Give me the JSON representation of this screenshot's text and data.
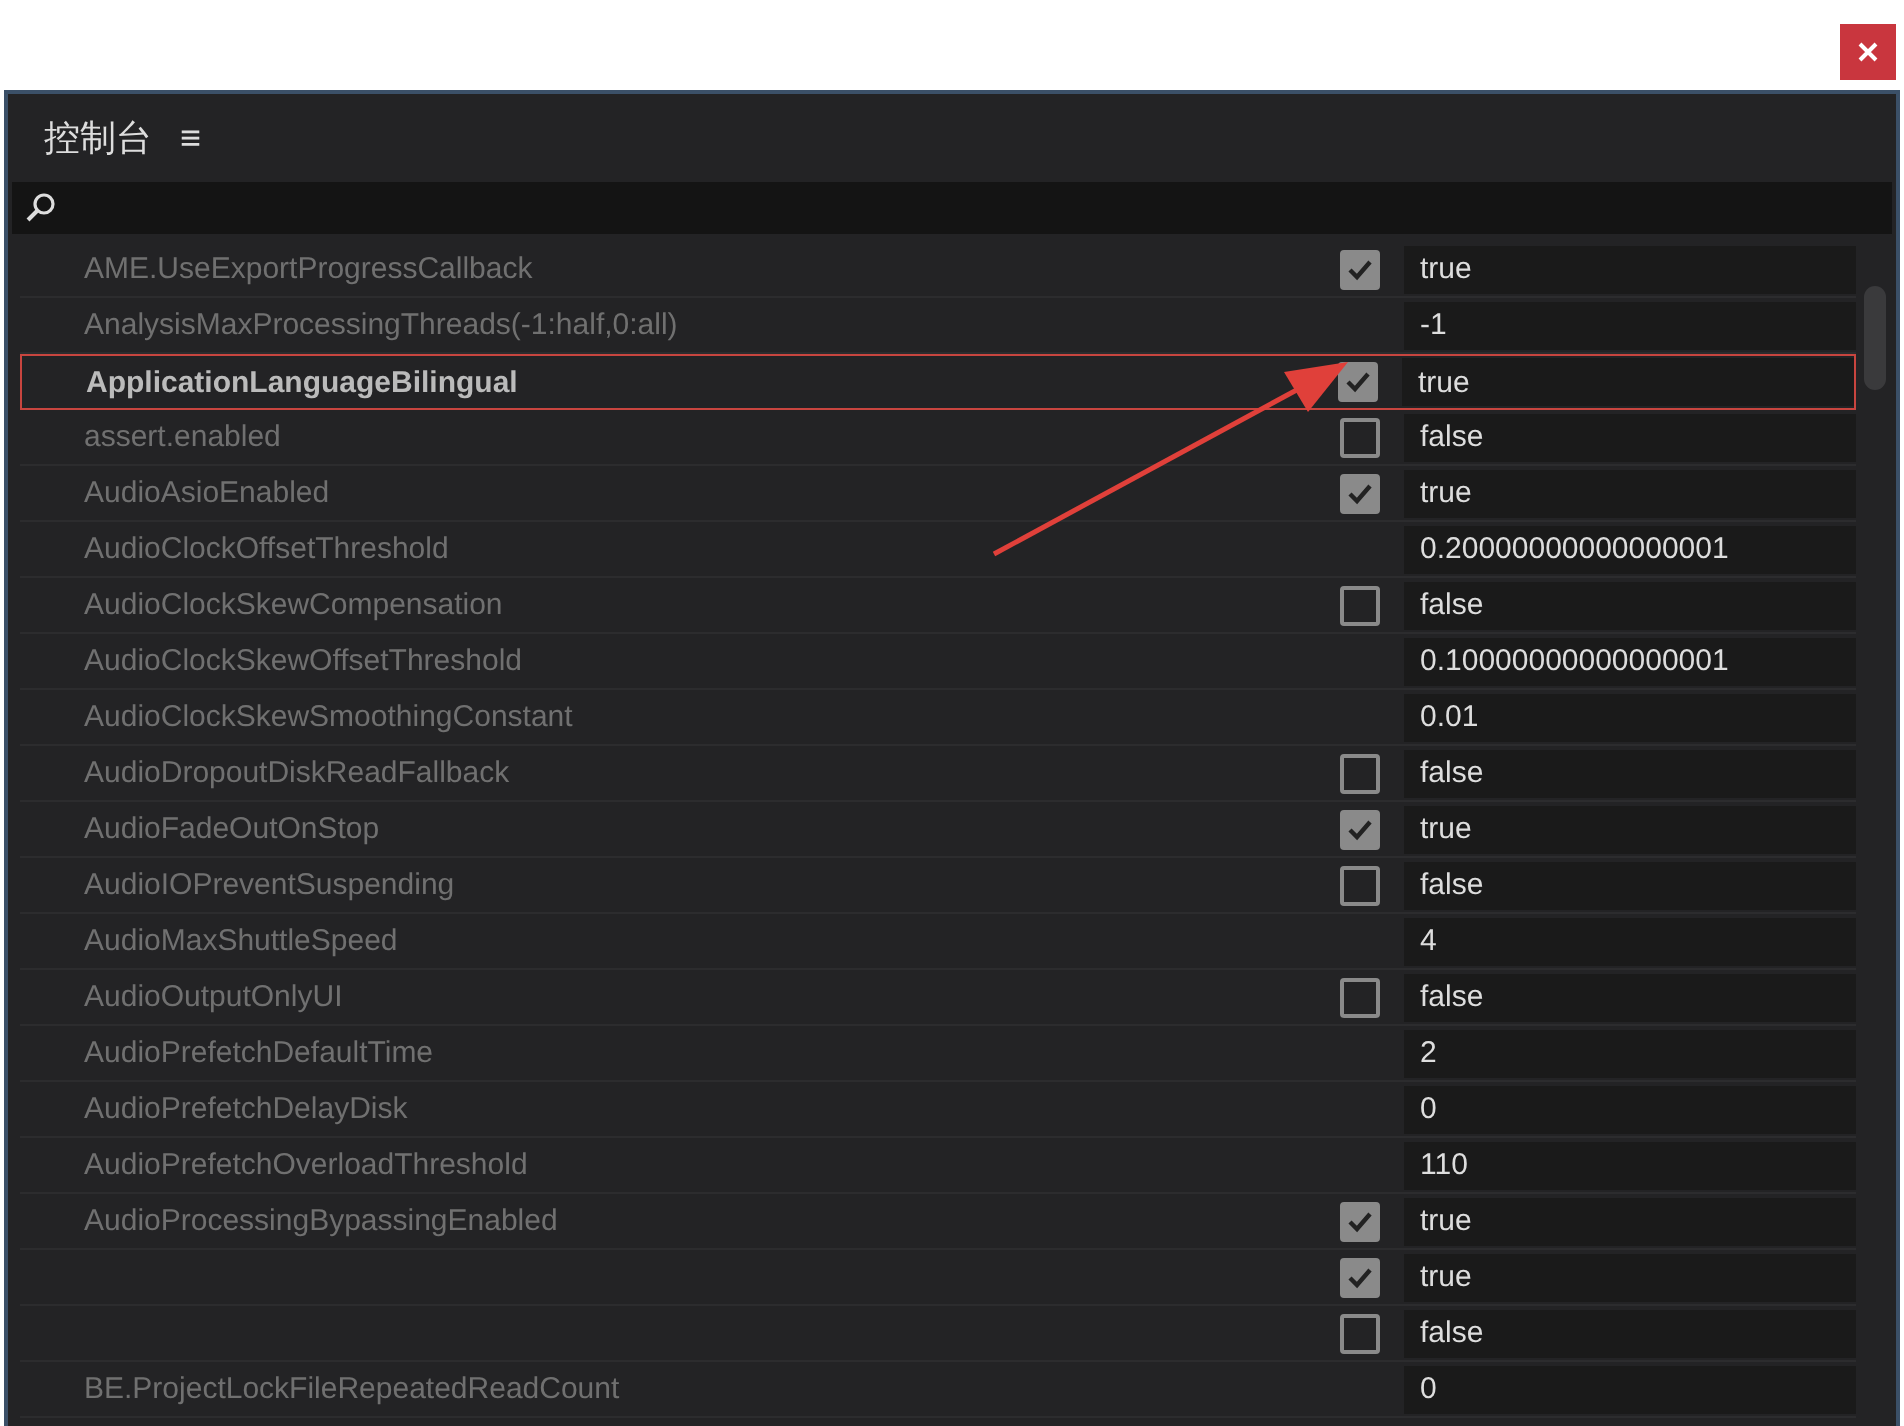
{
  "panel": {
    "title": "控制台",
    "menu_glyph": "≡"
  },
  "rows": [
    {
      "kind": "toggle",
      "name": "AME.UseExportProgressCallback",
      "checked": true,
      "value": "true",
      "annotated": false
    },
    {
      "kind": "value",
      "name": "AnalysisMaxProcessingThreads(-1:half,0:all)",
      "value": "-1",
      "annotated": false
    },
    {
      "kind": "toggle",
      "name": "ApplicationLanguageBilingual",
      "checked": true,
      "value": "true",
      "annotated": true
    },
    {
      "kind": "toggle",
      "name": "assert.enabled",
      "checked": false,
      "value": "false",
      "annotated": false
    },
    {
      "kind": "toggle",
      "name": "AudioAsioEnabled",
      "checked": true,
      "value": "true",
      "annotated": false
    },
    {
      "kind": "value",
      "name": "AudioClockOffsetThreshold",
      "value": "0.20000000000000001",
      "annotated": false
    },
    {
      "kind": "toggle",
      "name": "AudioClockSkewCompensation",
      "checked": false,
      "value": "false",
      "annotated": false
    },
    {
      "kind": "value",
      "name": "AudioClockSkewOffsetThreshold",
      "value": "0.10000000000000001",
      "annotated": false
    },
    {
      "kind": "value",
      "name": "AudioClockSkewSmoothingConstant",
      "value": "0.01",
      "annotated": false
    },
    {
      "kind": "toggle",
      "name": "AudioDropoutDiskReadFallback",
      "checked": false,
      "value": "false",
      "annotated": false
    },
    {
      "kind": "toggle",
      "name": "AudioFadeOutOnStop",
      "checked": true,
      "value": "true",
      "annotated": false
    },
    {
      "kind": "toggle",
      "name": "AudioIOPreventSuspending",
      "checked": false,
      "value": "false",
      "annotated": false
    },
    {
      "kind": "value",
      "name": "AudioMaxShuttleSpeed",
      "value": "4",
      "annotated": false
    },
    {
      "kind": "toggle",
      "name": "AudioOutputOnlyUI",
      "checked": false,
      "value": "false",
      "annotated": false
    },
    {
      "kind": "value",
      "name": "AudioPrefetchDefaultTime",
      "value": "2",
      "annotated": false
    },
    {
      "kind": "value",
      "name": "AudioPrefetchDelayDisk",
      "value": "0",
      "annotated": false
    },
    {
      "kind": "value",
      "name": "AudioPrefetchOverloadThreshold",
      "value": "110",
      "annotated": false
    },
    {
      "kind": "toggle",
      "name": "AudioProcessingBypassingEnabled",
      "checked": true,
      "value": "true",
      "annotated": false
    },
    {
      "kind": "toggle",
      "checked": true,
      "value": "true",
      "annotated": false
    },
    {
      "kind": "toggle",
      "checked": false,
      "value": "false",
      "annotated": false
    },
    {
      "kind": "value",
      "name": "BE.ProjectLockFileRepeatedReadCount",
      "value": "0",
      "annotated": false
    }
  ]
}
